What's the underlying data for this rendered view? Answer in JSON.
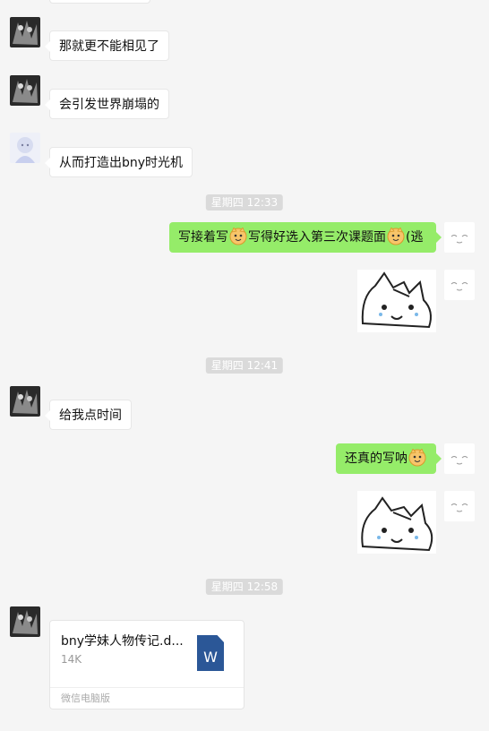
{
  "messages": {
    "m1": "那就更不能相见了",
    "m2": "会引发世界崩塌的",
    "m3": "从而打造出bny时光机",
    "m4_part1": "写接着写",
    "m4_part2": "写得好选入第三次课题面",
    "m4_part3": "(逃",
    "m5": "给我点时间",
    "m6": "还真的写呐"
  },
  "timestamps": {
    "t1": "星期四 12:33",
    "t2": "星期四 12:41",
    "t3": "星期四 12:58"
  },
  "file": {
    "name": "bny学妹人物传记.d...",
    "size": "14K",
    "icon_letter": "W",
    "source": "微信电脑版"
  },
  "colors": {
    "outgoing_bubble": "#95ec69",
    "incoming_bubble": "#ffffff",
    "background": "#f5f5f5",
    "word_icon": "#2b5797"
  }
}
